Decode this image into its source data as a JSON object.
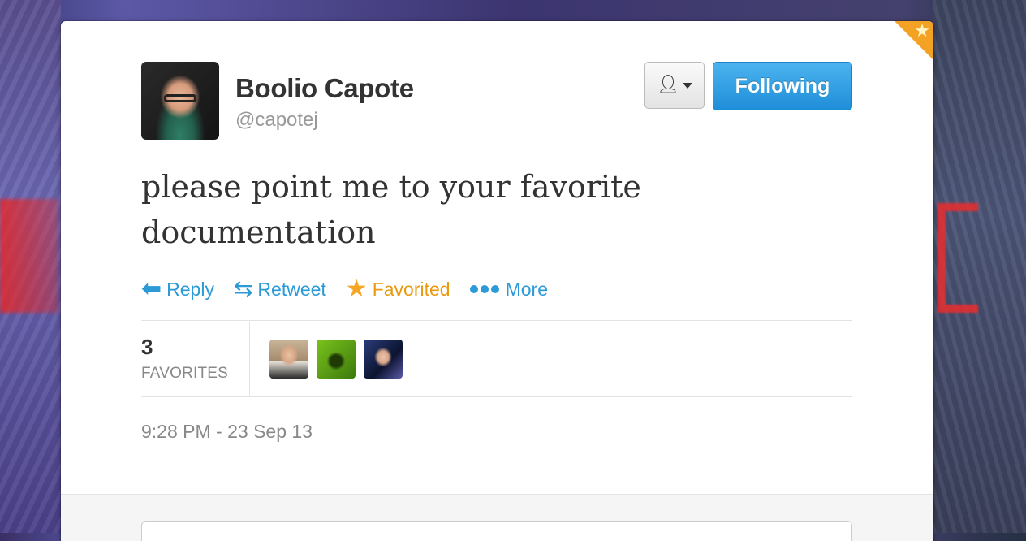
{
  "tweet": {
    "author_name": "Boolio Capote",
    "author_handle": "@capotej",
    "text": "please point me to your favorite documentation",
    "timestamp": "9:28 PM - 23 Sep 13"
  },
  "buttons": {
    "follow_label": "Following"
  },
  "actions": {
    "reply_label": "Reply",
    "retweet_label": "Retweet",
    "favorite_label": "Favorited",
    "more_label": "More"
  },
  "stats": {
    "favorites_count": "3",
    "favorites_label": "FAVORITES"
  },
  "colors": {
    "link": "#2b9ad6",
    "favorited": "#e99a10",
    "follow_button": "#1f8ed9"
  },
  "icons": {
    "reply": "reply-arrow-icon",
    "retweet": "retweet-icon",
    "favorite": "star-icon",
    "more": "dots-icon",
    "user_menu": "person-icon"
  }
}
